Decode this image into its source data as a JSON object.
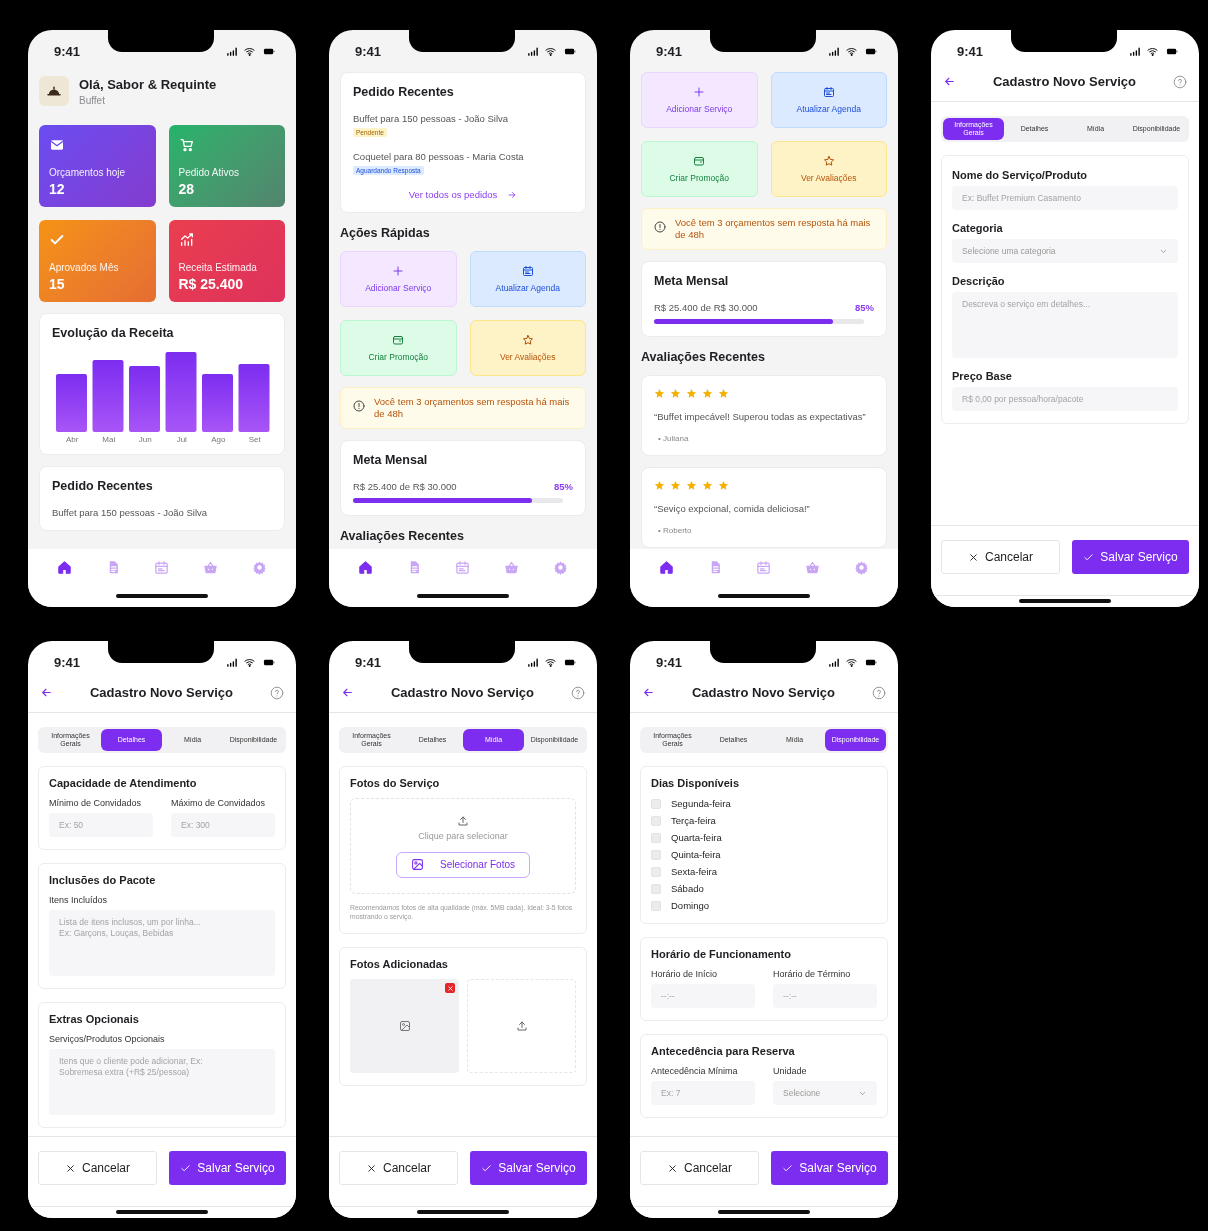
{
  "screens": [
    {
      "kind": "dashboard",
      "time": "9:41",
      "nav": [
        {
          "kind": "home",
          "selected": true
        },
        {
          "kind": "document",
          "selected": false
        },
        {
          "kind": "calendar",
          "selected": false
        },
        {
          "kind": "basket",
          "selected": false
        },
        {
          "kind": "gear",
          "selected": false
        }
      ],
      "sections": [
        {
          "kind": "greeting",
          "title": "Olá, Sabor & Requinte",
          "subtitle": "Buffet"
        },
        {
          "kind": "stats",
          "items": [
            {
              "kind": "mail",
              "label": "Orçamentos hoje",
              "value": "12",
              "color": "#6a4cf2"
            },
            {
              "kind": "cart",
              "label": "Pedido Ativos",
              "value": "28",
              "color": "#22b46a"
            },
            {
              "kind": "check",
              "label": "Aprovados  Mês",
              "value": "15",
              "color": "#f59313"
            },
            {
              "kind": "chart",
              "label": "Receita Estimada",
              "value": "R$ 25.400",
              "color": "#ea3e4f"
            }
          ]
        },
        {
          "kind": "chart",
          "title": "Evolução da Receita",
          "labels": [
            "Abr",
            "Mai",
            "Jun",
            "Jul",
            "Ago",
            "Set"
          ]
        },
        {
          "kind": "orders",
          "title": "Pedido Recentes",
          "orders": [
            {
              "text": "Buffet para 150 pessoas - João Silva"
            }
          ]
        }
      ]
    },
    {
      "kind": "dashboard",
      "time": "9:41",
      "nav": [
        {
          "kind": "home",
          "selected": true
        },
        {
          "kind": "document",
          "selected": false
        },
        {
          "kind": "calendar",
          "selected": false
        },
        {
          "kind": "basket",
          "selected": false
        },
        {
          "kind": "gear",
          "selected": false
        }
      ],
      "sections": [
        {
          "kind": "orders",
          "title": "Pedido Recentes",
          "orders": [
            {
              "text": "Buffet para 150 pessoas - João Silva",
              "status": "Pendente",
              "kind": "pending"
            },
            {
              "text": "Coquetel para 80 pessoas - Maria Costa",
              "status": "Aguardando Resposta",
              "kind": "waiting"
            }
          ],
          "link": "Ver todos os pedidos"
        },
        {
          "kind": "heading",
          "text": "Ações Rápidas"
        },
        {
          "kind": "actions",
          "items": [
            {
              "kind": "add",
              "label": "Adicionar Serviço"
            },
            {
              "kind": "calendar",
              "label": "Atualizar Agenda"
            },
            {
              "kind": "promo",
              "label": "Criar Promoção"
            },
            {
              "kind": "star",
              "label": "Ver Avaliações"
            }
          ]
        },
        {
          "kind": "alert",
          "text": "Você tem 3 orçamentos sem resposta há mais de 48h"
        },
        {
          "kind": "goal",
          "title": "Meta Mensal",
          "text": "R$ 25.400 de R$ 30.000",
          "reading": "85%",
          "level": 0.85
        },
        {
          "kind": "heading",
          "text": "Avaliações Recentes"
        }
      ]
    },
    {
      "kind": "dashboard",
      "time": "9:41",
      "nav": [
        {
          "kind": "home",
          "selected": true
        },
        {
          "kind": "document",
          "selected": false
        },
        {
          "kind": "calendar",
          "selected": false
        },
        {
          "kind": "basket",
          "selected": false
        },
        {
          "kind": "gear",
          "selected": false
        }
      ],
      "sections": [
        {
          "kind": "actions",
          "items": [
            {
              "kind": "add",
              "label": "Adicionar Serviço"
            },
            {
              "kind": "calendar",
              "label": "Atualizar Agenda"
            },
            {
              "kind": "promo",
              "label": "Criar Promoção"
            },
            {
              "kind": "star",
              "label": "Ver Avaliações"
            }
          ]
        },
        {
          "kind": "alert",
          "text": "Você tem 3 orçamentos sem resposta há mais de 48h"
        },
        {
          "kind": "goal",
          "title": "Meta Mensal",
          "text": "R$ 25.400 de R$ 30.000",
          "reading": "85%",
          "level": 0.85
        },
        {
          "kind": "heading",
          "text": "Avaliações Recentes"
        },
        {
          "kind": "review",
          "stars": 5,
          "quote": "“Buffet impecável! Superou todas as expectativas”",
          "author": "• Juliana"
        },
        {
          "kind": "review",
          "stars": 5,
          "quote": "“Seviço expcional, comida deliciosa!”",
          "author": "• Roberto"
        }
      ]
    },
    {
      "kind": "form",
      "time": "9:41",
      "title": "Cadastro Novo Serviço",
      "tabs": [
        {
          "label": "Informações Gerais",
          "selected": true
        },
        {
          "label": "Detalhes",
          "selected": false
        },
        {
          "label": "Mídia",
          "selected": false
        },
        {
          "label": "Disponibilidade",
          "selected": false
        }
      ],
      "cancel": "Cancelar",
      "save": "Salvar Serviço",
      "sections": [
        {
          "kind": "card",
          "fields": [
            {
              "kind": "input",
              "label": "Nome do Serviço/Produto",
              "placeholder": "Ex: Buffet Premium Casamento"
            },
            {
              "kind": "select",
              "label": "Categoria",
              "placeholder": "Selecione uma categoria"
            },
            {
              "kind": "textarea",
              "label": "Descrição",
              "placeholder": "Descreva o serviço em detalhes..."
            },
            {
              "kind": "input",
              "label": "Preço Base",
              "placeholder": "R$ 0,00 por pessoa/hora/pacote"
            }
          ]
        }
      ]
    },
    {
      "kind": "form",
      "time": "9:41",
      "title": "Cadastro Novo Serviço",
      "tabs": [
        {
          "label": "Informações Gerais",
          "selected": false
        },
        {
          "label": "Detalhes",
          "selected": true
        },
        {
          "label": "Mídia",
          "selected": false
        },
        {
          "label": "Disponibilidade",
          "selected": false
        }
      ],
      "cancel": "Cancelar",
      "save": "Salvar Serviço",
      "sections": [
        {
          "kind": "card",
          "title": "Capacidade de Atendimento",
          "fields": [
            {
              "kind": "row",
              "fields": [
                {
                  "kind": "input",
                  "label": "Mínimo de Convidados",
                  "placeholder": "Ex: 50"
                },
                {
                  "kind": "input",
                  "label": "Máximo de Convidados",
                  "placeholder": "Ex: 300"
                }
              ]
            }
          ]
        },
        {
          "kind": "card",
          "title": "Inclusões do Pacote",
          "fields": [
            {
              "kind": "textarea",
              "label": "Itens Incluídos",
              "placeholder": "Lista de itens inclusos, um por linha...\nEx: Garçons, Louças, Bebidas"
            }
          ]
        },
        {
          "kind": "card",
          "title": "Extras Opcionais",
          "fields": [
            {
              "kind": "textarea",
              "label": "Serviços/Produtos Opcionais",
              "placeholder": "Itens que o cliente pode adicionar, Ex:\nSobremesa extra (+R$ 25/pessoa)"
            }
          ]
        }
      ]
    },
    {
      "kind": "form",
      "time": "9:41",
      "title": "Cadastro Novo Serviço",
      "tabs": [
        {
          "label": "Informações Gerais",
          "selected": false
        },
        {
          "label": "Detalhes",
          "selected": false
        },
        {
          "label": "Mídia",
          "selected": true
        },
        {
          "label": "Disponibilidade",
          "selected": false
        }
      ],
      "cancel": "Cancelar",
      "save": "Salvar Serviço",
      "sections": [
        {
          "kind": "card",
          "title": "Fotos do Serviço",
          "fields": [
            {
              "kind": "upload",
              "prompt": "Clique para selecionar",
              "button": "Selecionar Fotos",
              "note": "Recomendamos fotos de alta qualidade (máx. 5MB cada). Ideal: 3-5 fotos mostrando o serviço."
            }
          ]
        },
        {
          "kind": "card",
          "title": "Fotos Adicionadas",
          "fields": [
            {
              "kind": "gallery"
            }
          ]
        }
      ]
    },
    {
      "kind": "form",
      "time": "9:41",
      "title": "Cadastro Novo Serviço",
      "tabs": [
        {
          "label": "Informações Gerais",
          "selected": false
        },
        {
          "label": "Detalhes",
          "selected": false
        },
        {
          "label": "Mídia",
          "selected": false
        },
        {
          "label": "Disponibilidade",
          "selected": true
        }
      ],
      "cancel": "Cancelar",
      "save": "Salvar Serviço",
      "sections": [
        {
          "kind": "card",
          "title": "Dias Disponíveis",
          "fields": [
            {
              "kind": "checks",
              "items": [
                {
                  "label": "Segunda-feira",
                  "checked": false
                },
                {
                  "label": "Terça-feira",
                  "checked": false
                },
                {
                  "label": "Quarta-feira",
                  "checked": false
                },
                {
                  "label": "Quinta-feira",
                  "checked": false
                },
                {
                  "label": "Sexta-feira",
                  "checked": false
                },
                {
                  "label": "Sábado",
                  "checked": false
                },
                {
                  "label": "Domingo",
                  "checked": false
                }
              ]
            }
          ]
        },
        {
          "kind": "card",
          "title": "Horário de Funcionamento",
          "fields": [
            {
              "kind": "row",
              "fields": [
                {
                  "kind": "input",
                  "label": "Horário de Início",
                  "placeholder": "--:--"
                },
                {
                  "kind": "input",
                  "label": "Horário de Término",
                  "placeholder": "--:--"
                }
              ]
            }
          ]
        },
        {
          "kind": "card",
          "title": "Antecedência para Reserva",
          "fields": [
            {
              "kind": "row",
              "fields": [
                {
                  "kind": "input",
                  "label": "Antecedência Mínima",
                  "placeholder": "Ex: 7"
                },
                {
                  "kind": "select",
                  "label": "Unidade",
                  "placeholder": "Selecione"
                }
              ]
            }
          ]
        }
      ]
    }
  ]
}
